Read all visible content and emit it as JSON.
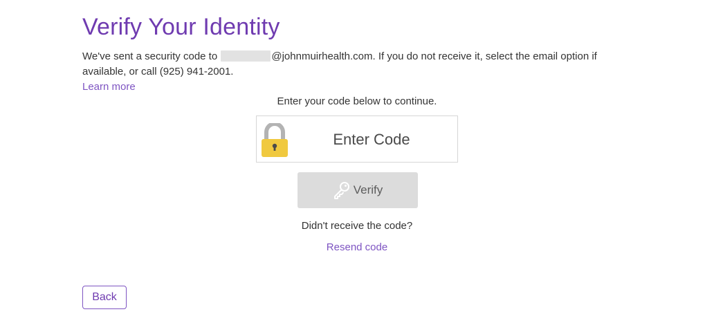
{
  "page": {
    "title": "Verify Your Identity",
    "description_prefix": "We've sent a security code to",
    "description_suffix": "@johnmuirhealth.com. If you do not receive it, select the email option if available, or call (925) 941-2001.",
    "learn_more": "Learn more",
    "instruction": "Enter your code below to continue."
  },
  "code_input": {
    "placeholder": "Enter Code",
    "value": ""
  },
  "verify_button": {
    "label": "Verify",
    "icon": "key-icon"
  },
  "resend": {
    "question": "Didn't receive the code?",
    "link": "Resend code"
  },
  "back_button": {
    "label": "Back"
  },
  "icons": {
    "lock": "lock-icon",
    "key": "key-icon"
  },
  "colors": {
    "title": "#6f3bb0",
    "link": "#7e54c2",
    "lock_body": "#f0c93f",
    "lock_shackle": "#b3b3b3",
    "verify_bg": "#dcdcdc"
  }
}
